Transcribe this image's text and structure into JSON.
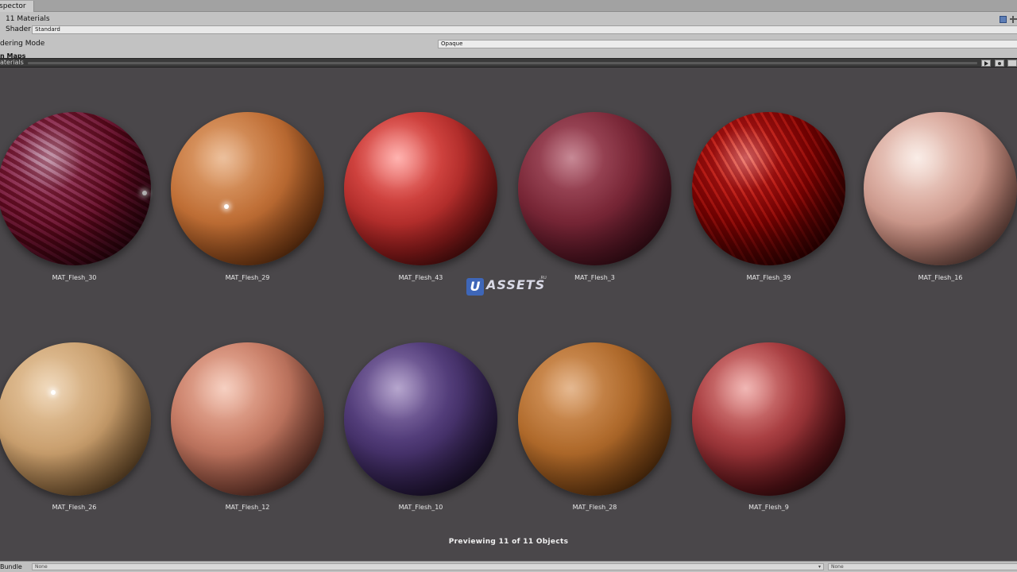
{
  "tab": {
    "label": "spector"
  },
  "header": {
    "title": "11 Materials"
  },
  "shader": {
    "label": "Shader",
    "value": "Standard"
  },
  "rendering": {
    "label": "dering Mode",
    "value": "Opaque"
  },
  "maps": {
    "label": "n Maps"
  },
  "preview_header": {
    "label": "aterials"
  },
  "materials": [
    {
      "name": "MAT_Flesh_30"
    },
    {
      "name": "MAT_Flesh_29"
    },
    {
      "name": "MAT_Flesh_43"
    },
    {
      "name": "MAT_Flesh_3"
    },
    {
      "name": "MAT_Flesh_39"
    },
    {
      "name": "MAT_Flesh_16"
    },
    {
      "name": "MAT_Flesh_26"
    },
    {
      "name": "MAT_Flesh_12"
    },
    {
      "name": "MAT_Flesh_10"
    },
    {
      "name": "MAT_Flesh_28"
    },
    {
      "name": "MAT_Flesh_9"
    }
  ],
  "watermark": {
    "mark": "U",
    "text": "ASSETS",
    "suffix": ".RU"
  },
  "status": {
    "text": "Previewing 11 of 11 Objects"
  },
  "bundle": {
    "label": "Bundle",
    "asset_value": "None",
    "variant_value": "None"
  }
}
